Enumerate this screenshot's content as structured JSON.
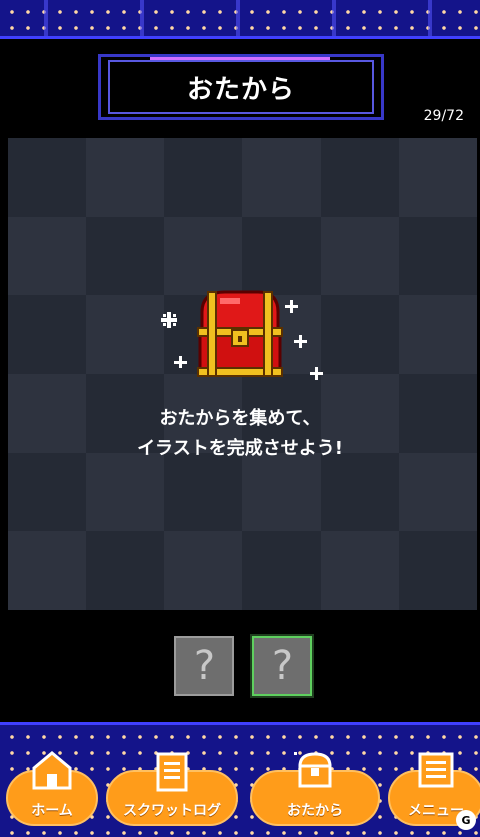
{
  "header": {
    "title": "おたから",
    "counter": "29/72"
  },
  "main": {
    "message_line1": "おたからを集めて、",
    "message_line2": "イラストを完成させよう!"
  },
  "slots": [
    {
      "label": "?",
      "selected": false
    },
    {
      "label": "?",
      "selected": true
    }
  ],
  "nav": {
    "home": "ホーム",
    "squat_log": "スクワットログ",
    "treasure": "おたから",
    "menu": "メニュー"
  },
  "colors": {
    "accent": "#ff9c1a",
    "maze": "#14148a",
    "board_dark": "#252a35",
    "board_light": "#2e333f"
  }
}
